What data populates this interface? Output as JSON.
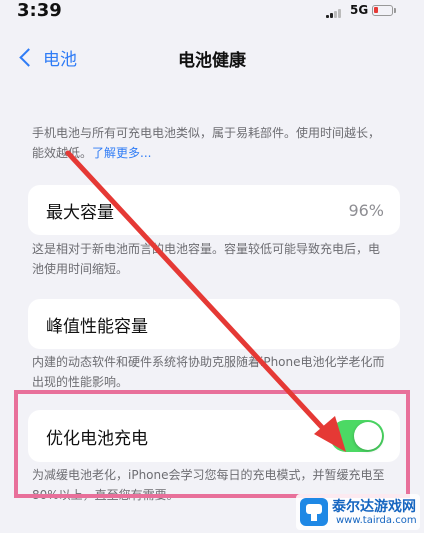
{
  "status_bar": {
    "time": "3:39",
    "network": "5G",
    "battery_color": "#e53935"
  },
  "nav": {
    "back_label": "电池",
    "title": "电池健康"
  },
  "intro": {
    "text": "手机电池与所有可充电电池类似，属于易耗部件。使用时间越长，能效越低。",
    "link": "了解更多..."
  },
  "max_capacity": {
    "label": "最大容量",
    "value": "96%",
    "description": "这是相对于新电池而言的电池容量。容量较低可能导致充电后，电池使用时间缩短。"
  },
  "peak_performance": {
    "label": "峰值性能容量",
    "description": "内建的动态软件和硬件系统将协助克服随着iPhone电池化学老化而出现的性能影响。"
  },
  "optimized_charging": {
    "label": "优化电池充电",
    "enabled": true,
    "toggle_color": "#4cd964",
    "description": "为减缓电池老化，iPhone会学习您每日的充电模式，并暂缓充电至80%以上，直至您有需要。"
  },
  "annotation": {
    "highlight_color": "#e8709a",
    "arrow_color": "#e53935"
  },
  "watermark": {
    "name": "泰尔达游戏网",
    "url": "www.tairda.com"
  }
}
